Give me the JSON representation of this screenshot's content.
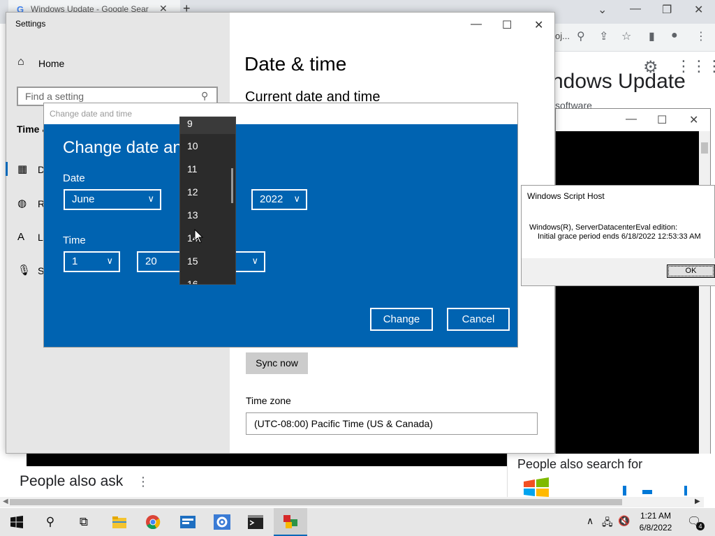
{
  "browser": {
    "tab_title": "Windows Update - Google Sear",
    "url_fragment": "oj...",
    "heading_partial": "ndows Update",
    "subtext_partial": "software",
    "people_also_ask": "People also ask",
    "people_also_search": "People also search for"
  },
  "settings": {
    "window_title": "Settings",
    "home_label": "Home",
    "search_placeholder": "Find a setting",
    "section_label": "Time & Language",
    "sidebar_items": [
      {
        "letter": "D"
      },
      {
        "letter": "R"
      },
      {
        "letter": "L"
      },
      {
        "letter": "S"
      }
    ],
    "page_title": "Date & time",
    "current_heading": "Current date and time",
    "sync_button": "Sync now",
    "timezone_label": "Time zone",
    "timezone_value": "(UTC-08:00) Pacific Time (US & Canada)"
  },
  "dialog": {
    "title": "Change date and time",
    "heading": "Change date and time",
    "date_label": "Date",
    "month_value": "June",
    "year_value": "2022",
    "time_label": "Time",
    "hour_value": "1",
    "minute_value": "20",
    "change_button": "Change",
    "cancel_button": "Cancel",
    "day_options": [
      "9",
      "10",
      "11",
      "12",
      "13",
      "14",
      "15",
      "16"
    ]
  },
  "wsh": {
    "title": "Windows Script Host",
    "line1": "Windows(R), ServerDatacenterEval edition:",
    "line2": "Initial grace period ends 6/18/2022 12:53:33 AM",
    "ok_button": "OK"
  },
  "taskbar": {
    "time": "1:21 AM",
    "date": "6/8/2022",
    "notification_count": "4",
    "accent_color": "#0067b8"
  },
  "colors": {
    "dialog_blue": "#0063b1",
    "settings_gray": "#e6e6e6",
    "dropdown_dark": "#2b2b2b"
  }
}
